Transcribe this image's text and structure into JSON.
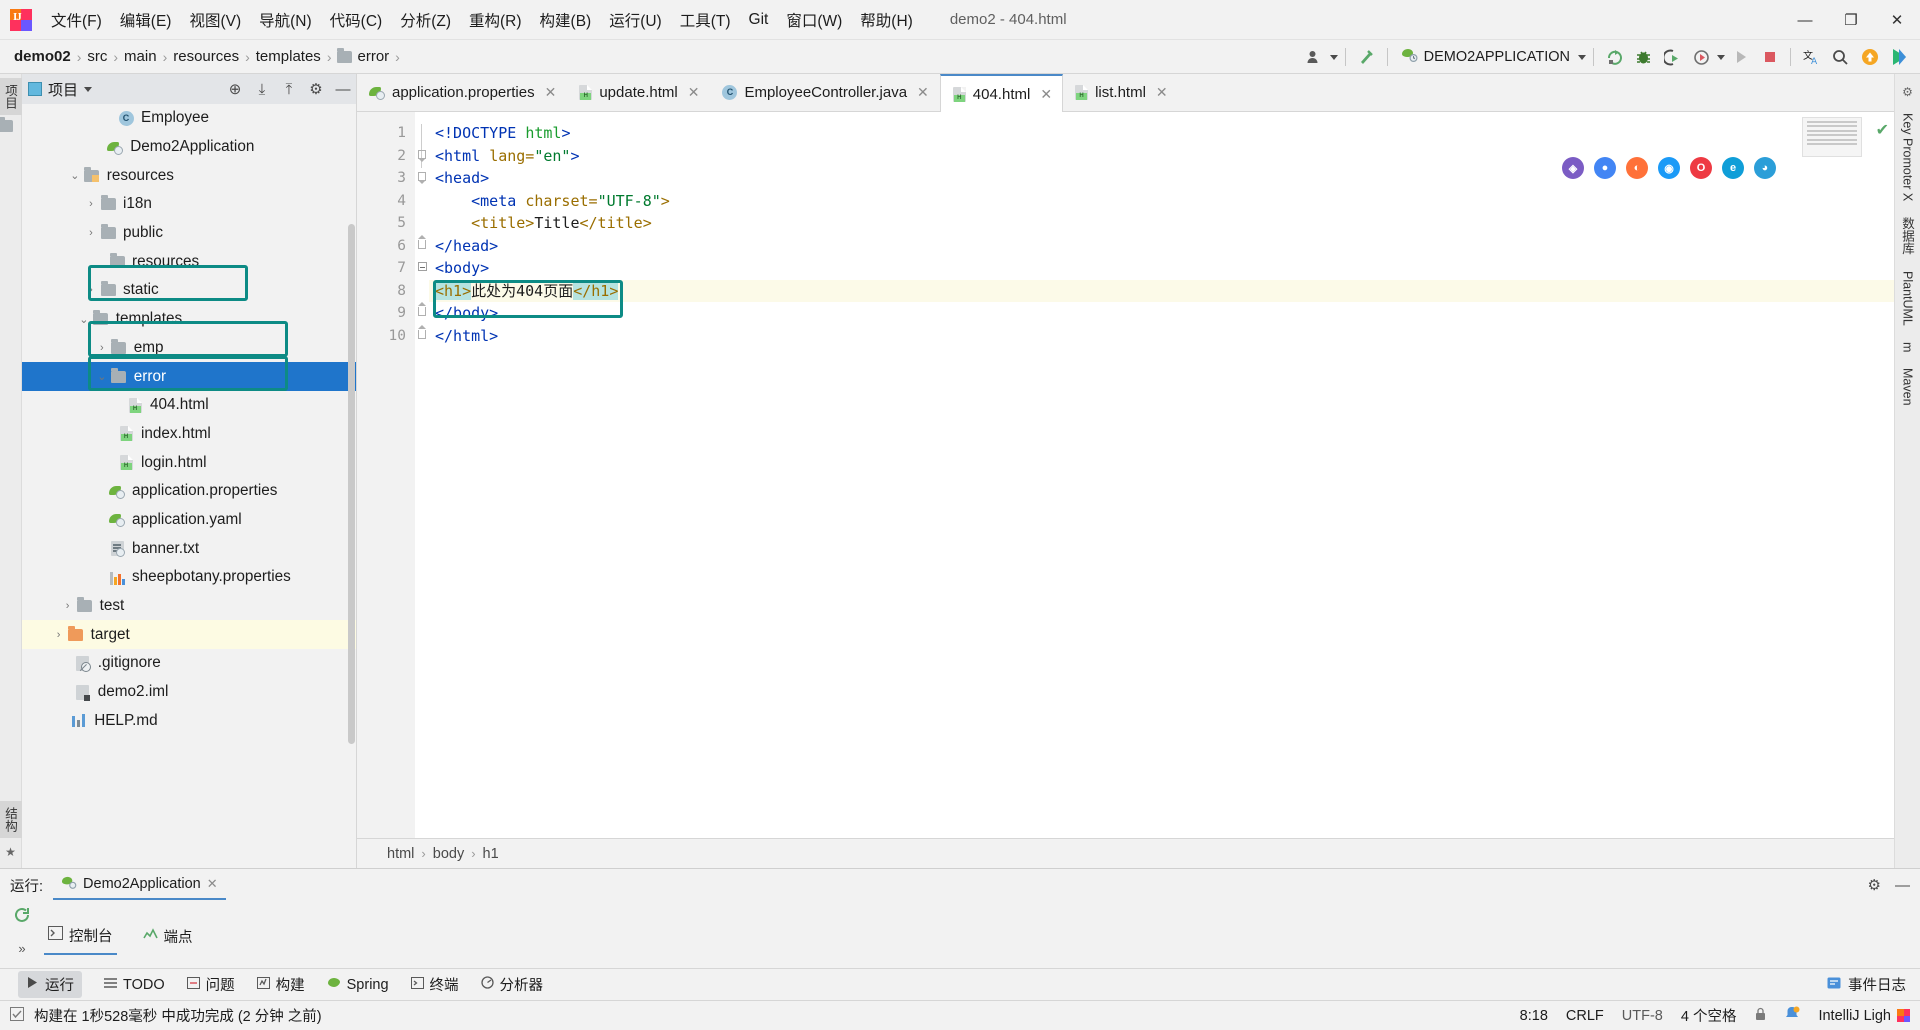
{
  "window": {
    "title": "demo2 - 404.html",
    "minimize_label": "—",
    "maximize_label": "❐",
    "close_label": "✕"
  },
  "menubar": {
    "items": [
      {
        "label": "文件(F)"
      },
      {
        "label": "编辑(E)"
      },
      {
        "label": "视图(V)"
      },
      {
        "label": "导航(N)"
      },
      {
        "label": "代码(C)"
      },
      {
        "label": "分析(Z)"
      },
      {
        "label": "重构(R)"
      },
      {
        "label": "构建(B)"
      },
      {
        "label": "运行(U)"
      },
      {
        "label": "工具(T)"
      },
      {
        "label": "Git"
      },
      {
        "label": "窗口(W)"
      },
      {
        "label": "帮助(H)"
      }
    ]
  },
  "navbar": {
    "breadcrumbs": [
      {
        "label": "demo02",
        "bold": true,
        "folder": false
      },
      {
        "label": "src",
        "bold": false,
        "folder": false
      },
      {
        "label": "main",
        "bold": false,
        "folder": false
      },
      {
        "label": "resources",
        "bold": false,
        "folder": false
      },
      {
        "label": "templates",
        "bold": false,
        "folder": false
      },
      {
        "label": "error",
        "bold": false,
        "folder": true
      }
    ],
    "separator": "›",
    "run_configuration": "DEMO2APPLICATION",
    "toolbar_icons": [
      {
        "name": "user-account-icon",
        "glyph": "👤"
      },
      {
        "name": "build-hammer-icon",
        "glyph": "╱"
      },
      {
        "name": "rerun-icon",
        "glyph": "↻"
      },
      {
        "name": "debug-bug-icon",
        "glyph": "🐞"
      },
      {
        "name": "coverage-icon",
        "glyph": "▶"
      },
      {
        "name": "profiler-icon",
        "glyph": "◔"
      },
      {
        "name": "run-icon",
        "glyph": "▶"
      },
      {
        "name": "stop-icon",
        "glyph": "■"
      },
      {
        "name": "translate-icon",
        "glyph": "文A"
      },
      {
        "name": "search-everywhere-icon",
        "glyph": "⚲"
      },
      {
        "name": "update-badge-icon",
        "glyph": "↑"
      },
      {
        "name": "ide-feature-icon",
        "glyph": "▶"
      }
    ]
  },
  "left_rail": {
    "tabs": [
      {
        "label": "项目"
      }
    ],
    "bottom_icons": [
      {
        "name": "structure-icon",
        "label": "结构"
      },
      {
        "name": "bookmarks-icon",
        "label": "★"
      }
    ]
  },
  "project_panel": {
    "title": "项目",
    "dropdown": "▾",
    "header_icons": [
      {
        "name": "locate-file-icon",
        "glyph": "⊕"
      },
      {
        "name": "expand-all-icon",
        "glyph": "⤓"
      },
      {
        "name": "collapse-all-icon",
        "glyph": "⤒"
      },
      {
        "name": "settings-gear-icon",
        "glyph": "⚙"
      },
      {
        "name": "hide-panel-icon",
        "glyph": "—"
      }
    ],
    "tree": [
      {
        "label": "Employee",
        "indent": 4,
        "icon": "class",
        "arrow": "none",
        "state": "normal"
      },
      {
        "label": "Demo2Application",
        "indent": 3.4,
        "icon": "spring",
        "arrow": "none",
        "state": "normal"
      },
      {
        "label": "resources",
        "indent": 2.1,
        "icon": "folder-res",
        "arrow": "down",
        "state": "normal"
      },
      {
        "label": "i18n",
        "indent": 3.0,
        "icon": "folder",
        "arrow": "right",
        "state": "normal"
      },
      {
        "label": "public",
        "indent": 3.0,
        "icon": "folder",
        "arrow": "right",
        "state": "normal"
      },
      {
        "label": "resources",
        "indent": 3.5,
        "icon": "folder",
        "arrow": "none",
        "state": "normal"
      },
      {
        "label": "static",
        "indent": 3.0,
        "icon": "folder",
        "arrow": "right",
        "state": "normal"
      },
      {
        "label": "templates",
        "indent": 2.6,
        "icon": "folder",
        "arrow": "down",
        "state": "annotated"
      },
      {
        "label": "emp",
        "indent": 3.6,
        "icon": "folder",
        "arrow": "right",
        "state": "normal"
      },
      {
        "label": "error",
        "indent": 3.6,
        "icon": "folder",
        "arrow": "down",
        "state": "selected"
      },
      {
        "label": "404.html",
        "indent": 4.5,
        "icon": "html",
        "arrow": "none",
        "state": "annotated"
      },
      {
        "label": "index.html",
        "indent": 4.0,
        "icon": "html",
        "arrow": "none",
        "state": "normal"
      },
      {
        "label": "login.html",
        "indent": 4.0,
        "icon": "html",
        "arrow": "none",
        "state": "normal"
      },
      {
        "label": "application.properties",
        "indent": 3.5,
        "icon": "spring",
        "arrow": "none",
        "state": "normal"
      },
      {
        "label": "application.yaml",
        "indent": 3.5,
        "icon": "spring",
        "arrow": "none",
        "state": "normal"
      },
      {
        "label": "banner.txt",
        "indent": 3.5,
        "icon": "txt",
        "arrow": "none",
        "state": "normal"
      },
      {
        "label": "sheepbotany.properties",
        "indent": 3.5,
        "icon": "prop",
        "arrow": "none",
        "state": "normal"
      },
      {
        "label": "test",
        "indent": 1.7,
        "icon": "folder",
        "arrow": "right",
        "state": "normal"
      },
      {
        "label": "target",
        "indent": 1.2,
        "icon": "folder-orange",
        "arrow": "right",
        "state": "highlight"
      },
      {
        "label": ".gitignore",
        "indent": 1.6,
        "icon": "git",
        "arrow": "none",
        "state": "normal"
      },
      {
        "label": "demo2.iml",
        "indent": 1.6,
        "icon": "iml",
        "arrow": "none",
        "state": "normal"
      },
      {
        "label": "HELP.md",
        "indent": 1.4,
        "icon": "md",
        "arrow": "none",
        "state": "normal"
      }
    ]
  },
  "editor": {
    "tabs": [
      {
        "label": "application.properties",
        "icon": "spring",
        "active": false,
        "close": "✕"
      },
      {
        "label": "update.html",
        "icon": "html",
        "active": false,
        "close": "✕"
      },
      {
        "label": "EmployeeController.java",
        "icon": "class",
        "active": false,
        "close": "✕"
      },
      {
        "label": "404.html",
        "icon": "html",
        "active": true,
        "close": "✕"
      },
      {
        "label": "list.html",
        "icon": "html",
        "active": false,
        "close": "✕"
      }
    ],
    "line_numbers": [
      "1",
      "2",
      "3",
      "4",
      "5",
      "6",
      "7",
      "8",
      "9",
      "10"
    ],
    "highlighted_line": 8,
    "code_lines": [
      {
        "n": 1,
        "segments": [
          {
            "t": "<!DOCTYPE ",
            "c": "doctype"
          },
          {
            "t": "html",
            "c": "doctype-name"
          },
          {
            "t": ">",
            "c": "doctype"
          }
        ],
        "indent": 0
      },
      {
        "n": 2,
        "segments": [
          {
            "t": "<html ",
            "c": "tag"
          },
          {
            "t": "lang=",
            "c": "attr"
          },
          {
            "t": "\"en\"",
            "c": "str"
          },
          {
            "t": ">",
            "c": "tag"
          }
        ],
        "indent": 0
      },
      {
        "n": 3,
        "segments": [
          {
            "t": "<head>",
            "c": "tag"
          }
        ],
        "indent": 0
      },
      {
        "n": 4,
        "segments": [
          {
            "t": "<meta ",
            "c": "tag"
          },
          {
            "t": "charset=",
            "c": "attr"
          },
          {
            "t": "\"UTF-8\"",
            "c": "str"
          },
          {
            "t": ">",
            "c": "attr"
          }
        ],
        "indent": 4
      },
      {
        "n": 5,
        "segments": [
          {
            "t": "<title>",
            "c": "attr"
          },
          {
            "t": "Title",
            "c": "txt"
          },
          {
            "t": "</title>",
            "c": "attr"
          }
        ],
        "indent": 4
      },
      {
        "n": 6,
        "segments": [
          {
            "t": "</head>",
            "c": "tag"
          }
        ],
        "indent": 0
      },
      {
        "n": 7,
        "segments": [
          {
            "t": "<body>",
            "c": "tag"
          }
        ],
        "indent": 0
      },
      {
        "n": 8,
        "segments": [
          {
            "t": "<h1>",
            "c": "attr sel-tok"
          },
          {
            "t": "此处为404页面",
            "c": "txt"
          },
          {
            "t": "</h1>",
            "c": "attr sel-tok"
          }
        ],
        "indent": 0
      },
      {
        "n": 9,
        "segments": [
          {
            "t": "</body>",
            "c": "tag"
          }
        ],
        "indent": 0
      },
      {
        "n": 10,
        "segments": [
          {
            "t": "</html>",
            "c": "tag"
          }
        ],
        "indent": 0
      }
    ],
    "structure_breadcrumb": [
      "html",
      "body",
      "h1"
    ],
    "breadcrumb_separator": "›",
    "inspection_status": "✔",
    "browser_icons": [
      {
        "name": "jetbrains-browser-icon",
        "color": "#7b5cc4",
        "glyph": "⌘"
      },
      {
        "name": "chrome-browser-icon",
        "color": "#4285f4",
        "glyph": "●"
      },
      {
        "name": "firefox-browser-icon",
        "color": "#ff7139",
        "glyph": "●"
      },
      {
        "name": "safari-browser-icon",
        "color": "#1b9af7",
        "glyph": "◉"
      },
      {
        "name": "opera-browser-icon",
        "color": "#ee3a43",
        "glyph": "O"
      },
      {
        "name": "edge-legacy-browser-icon",
        "color": "#0f9ed8",
        "glyph": "e"
      },
      {
        "name": "edge-browser-icon",
        "color": "#2b9ed8",
        "glyph": "◕"
      }
    ]
  },
  "right_rail": {
    "tabs": [
      {
        "label": "Key Promoter X"
      },
      {
        "label": "数据库"
      },
      {
        "label": "PlantUML"
      },
      {
        "label": "m"
      },
      {
        "label": "Maven"
      }
    ]
  },
  "run_panel": {
    "label": "运行:",
    "tab_name": "Demo2Application",
    "tab_close": "✕",
    "subtabs": [
      {
        "label": "控制台",
        "icon": "console-icon",
        "active": true
      },
      {
        "label": "端点",
        "icon": "endpoints-icon",
        "active": false
      }
    ],
    "header_icons": [
      {
        "name": "settings-gear-icon",
        "glyph": "⚙"
      },
      {
        "name": "hide-panel-icon",
        "glyph": "—"
      }
    ],
    "side_icons": [
      {
        "name": "rerun-icon",
        "glyph": "↺"
      },
      {
        "name": "expand-icon",
        "glyph": "»"
      }
    ]
  },
  "toolwindow_bar": {
    "items": [
      {
        "label": "运行",
        "icon": "run-icon",
        "active": true
      },
      {
        "label": "TODO",
        "icon": "todo-icon",
        "active": false
      },
      {
        "label": "问题",
        "icon": "problems-icon",
        "active": false
      },
      {
        "label": "构建",
        "icon": "build-icon",
        "active": false
      },
      {
        "label": "Spring",
        "icon": "spring-icon",
        "active": false
      },
      {
        "label": "终端",
        "icon": "terminal-icon",
        "active": false
      },
      {
        "label": "分析器",
        "icon": "profiler-icon",
        "active": false
      }
    ],
    "right": {
      "label": "事件日志",
      "icon": "event-log-icon"
    }
  },
  "statusbar": {
    "message": "构建在 1秒528毫秒 中成功完成 (2 分钟 之前)",
    "caret_position": "8:18",
    "line_separator": "CRLF",
    "encoding": "UTF-8",
    "indent": "4 个空格",
    "ide_name": "IntelliJ Ligh",
    "lock_icon": "🔒",
    "notification_icon": "🔔"
  },
  "colors": {
    "annotation_box": "#0d8b85",
    "selection_blue": "#1f75cb",
    "highlight_yellow": "#fdfbe3",
    "accent_tab": "#4a89c8"
  }
}
